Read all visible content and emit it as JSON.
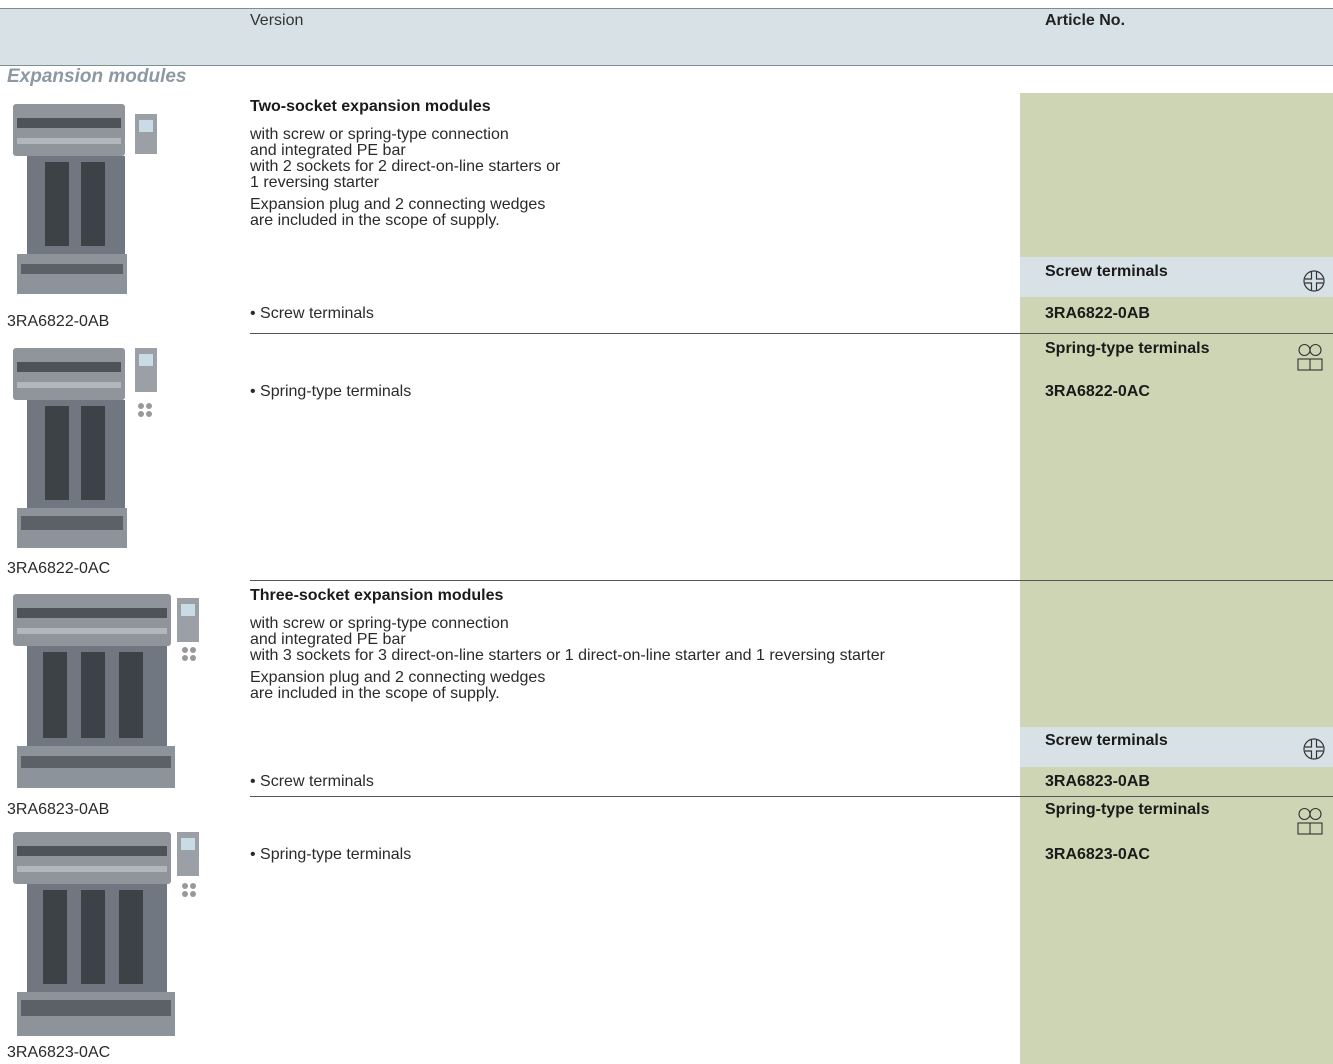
{
  "header": {
    "version_label": "Version",
    "article_label": "Article No."
  },
  "section_title": "Expansion modules",
  "groups": [
    {
      "title": "Two-socket expansion modules",
      "desc1": [
        "with screw or spring-type connection",
        "and integrated PE bar",
        "with 2 sockets for 2 direct-on-line starters or",
        "1 reversing starter"
      ],
      "desc2": [
        "Expansion plug and 2 connecting wedges",
        "are included in the scope of supply."
      ],
      "rows": [
        {
          "terminal_type": "Screw terminals",
          "bullet": "• Screw terminals",
          "article": "3RA6822-0AB",
          "caption": "3RA6822-0AB",
          "icon": "screw-terminal-icon"
        },
        {
          "terminal_type": "Spring-type terminals",
          "bullet": "• Spring-type terminals",
          "article": "3RA6822-0AC",
          "caption": "3RA6822-0AC",
          "icon": "spring-terminal-icon"
        }
      ]
    },
    {
      "title": "Three-socket expansion modules",
      "desc1": [
        "with screw or spring-type connection",
        "and integrated PE bar",
        "with 3 sockets for 3 direct-on-line starters or 1 direct-on-line starter and 1 reversing starter"
      ],
      "desc2": [
        "Expansion plug and 2 connecting wedges",
        "are included in the scope of supply."
      ],
      "rows": [
        {
          "terminal_type": "Screw terminals",
          "bullet": "• Screw terminals",
          "article": "3RA6823-0AB",
          "caption": "3RA6823-0AB",
          "icon": "screw-terminal-icon"
        },
        {
          "terminal_type": "Spring-type terminals",
          "bullet": "• Spring-type terminals",
          "article": "3RA6823-0AC",
          "caption": "3RA6823-0AC",
          "icon": "spring-terminal-icon"
        }
      ]
    }
  ]
}
